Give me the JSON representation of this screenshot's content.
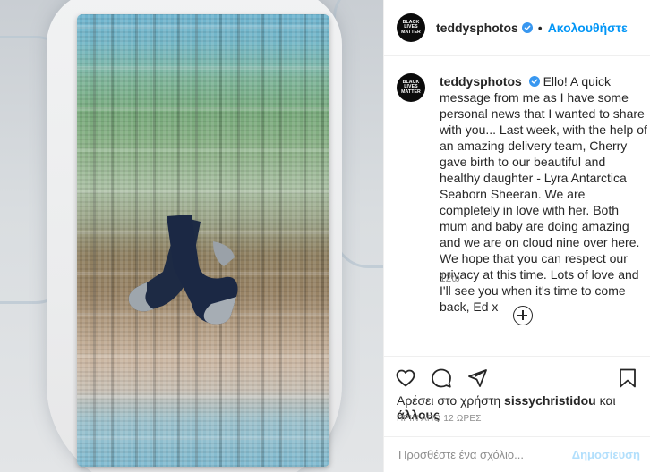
{
  "post": {
    "author": {
      "username": "teddysphotos",
      "verified": true,
      "avatar_text": [
        "BLACK",
        "LIVES",
        "MATTER"
      ]
    },
    "follow_label": "Ακολουθήστε",
    "header_separator": "•",
    "caption": {
      "username": "teddysphotos",
      "text": "Ello! A quick message from me as I have some personal news that I wanted to share with you... Last week, with the help of an amazing delivery team, Cherry gave birth to our beautiful and healthy daughter - Lyra Antarctica Seaborn Sheeran. We are completely in love with her. Both mum and baby are doing amazing and we are on cloud nine over here. We hope that you can respect our privacy at this time. Lots of love and I'll see you when it's time to come back, Ed x",
      "time_ago": "12ω"
    },
    "likes": {
      "prefix": "Αρέσει στο χρήστη",
      "user": "sissychristidou",
      "suffix": "και",
      "others": "άλλους"
    },
    "date": "ΠΡΙΝ ΑΠΟ 12 ΩΡΕΣ",
    "add_comment": {
      "placeholder": "Προσθέστε ένα σχόλιο...",
      "post_label": "Δημοσίευση"
    }
  },
  "icons": {
    "verified": "verified-badge-icon",
    "load_more": "plus-circle-icon",
    "like": "heart-icon",
    "comment": "comment-icon",
    "share": "paper-plane-icon",
    "save": "bookmark-icon"
  },
  "colors": {
    "link_blue": "#0095f6",
    "post_disabled": "#b2dffc",
    "text_primary": "#262626",
    "text_secondary": "#8e8e8e",
    "divider": "#efefef"
  }
}
